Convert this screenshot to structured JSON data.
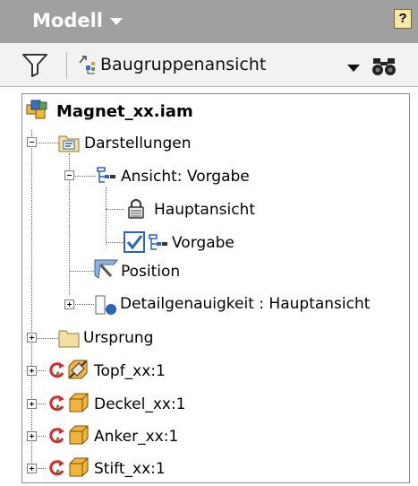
{
  "panel": {
    "title": "Modell",
    "help_label": "?"
  },
  "toolbar": {
    "view_label": "Baugruppenansicht"
  },
  "tree": {
    "root": "Magnet_xx.iam",
    "darstellungen": "Darstellungen",
    "ansicht": "Ansicht: Vorgabe",
    "hauptansicht": "Hauptansicht",
    "vorgabe": "Vorgabe",
    "position": "Position",
    "detail": "Detailgenauigkeit : Hauptansicht",
    "ursprung": "Ursprung",
    "topf": "Topf_xx:1",
    "deckel": "Deckel_xx:1",
    "anker": "Anker_xx:1",
    "stift": "Stift_xx:1"
  },
  "colors": {
    "header_bg": "#a0a0a0",
    "toolbar_bg": "#f2f2f2",
    "part_orange": "#f2b43c",
    "refresh_red": "#d8282a",
    "check_blue": "#2a63b8"
  }
}
